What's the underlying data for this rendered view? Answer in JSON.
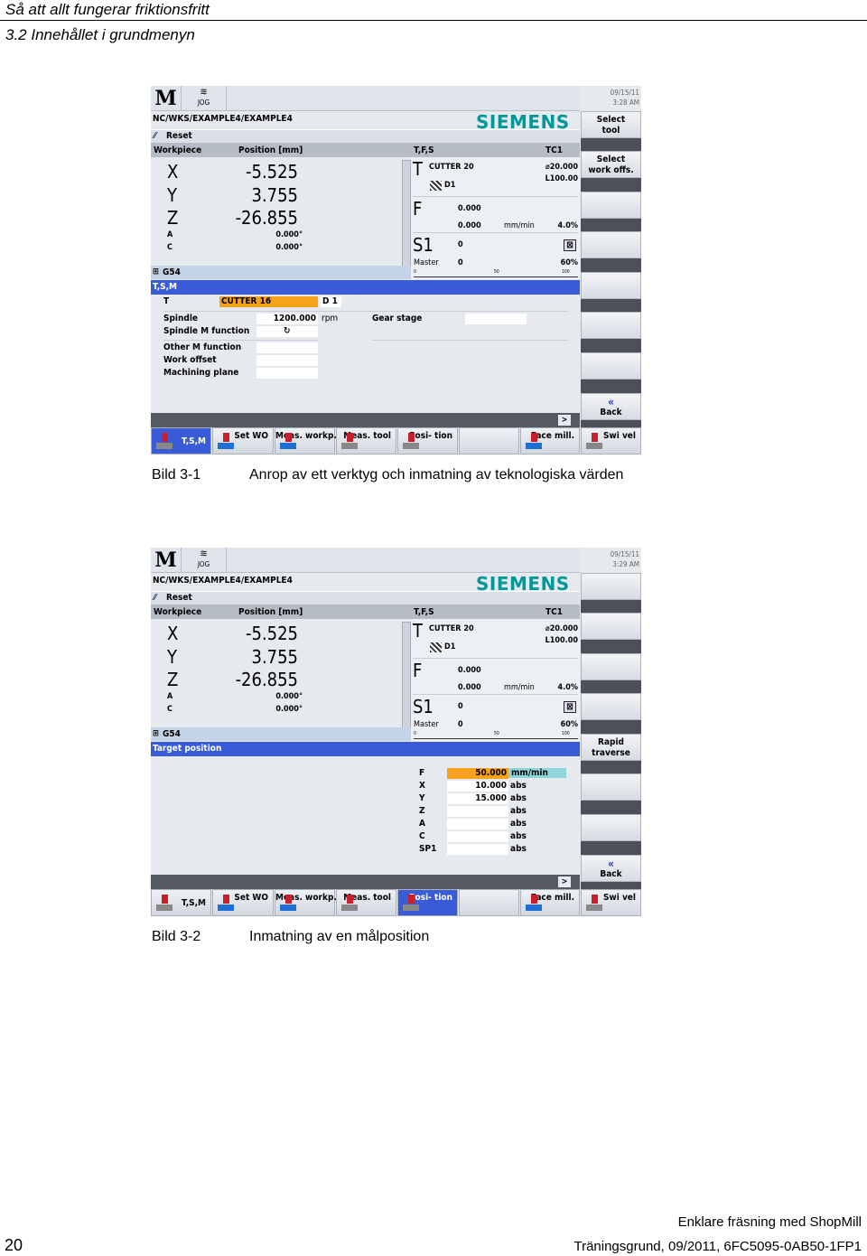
{
  "document": {
    "header_title": "Så att allt fungerar friktionsfritt",
    "header_subtitle": "3.2 Innehållet i grundmenyn",
    "figures": [
      {
        "label": "Bild 3-1",
        "caption": "Anrop av ett verktyg och inmatning av teknologiska värden"
      },
      {
        "label": "Bild 3-2",
        "caption": "Inmatning av en målposition"
      }
    ],
    "footer": {
      "page_number": "20",
      "line1": "Enklare fräsning med ShopMill",
      "line2": "Träningsgrund, 09/2011, 6FC5095-0AB50-1FP1"
    }
  },
  "colors": {
    "brand": "#00999a",
    "active_blue": "#3a5bd8",
    "highlight_orange": "#f7a21b",
    "unit_teal": "#8fd6dc"
  },
  "screens": [
    {
      "mode_icon": "M",
      "mode": "JOG",
      "date": "09/15/11",
      "time": "3:28 AM",
      "path": "NC/WKS/EXAMPLE4/EXAMPLE4",
      "brand": "SIEMENS",
      "status": "Reset",
      "pos_header": {
        "workpiece": "Workpiece",
        "position": "Position [mm]"
      },
      "axes": [
        {
          "name": "X",
          "value": "-5.525"
        },
        {
          "name": "Y",
          "value": "3.755"
        },
        {
          "name": "Z",
          "value": "-26.855"
        },
        {
          "name": "A",
          "value": "0.000°"
        },
        {
          "name": "C",
          "value": "0.000°"
        }
      ],
      "tfs": {
        "title": "T,F,S",
        "channel": "TC1",
        "t_letter": "T",
        "tool": "CUTTER 20",
        "diameter": "⌀20.000",
        "length": "L100.00",
        "d": "D1",
        "f_letter": "F",
        "f_actual": "0.000",
        "f_set": "0.000",
        "f_unit": "mm/min",
        "f_override": "4.0%",
        "s_letter": "S1",
        "s_actual": "0",
        "s_master": "Master",
        "s_set": "0",
        "s_override": "60%",
        "scale": [
          "0",
          "50",
          "100"
        ]
      },
      "g54": "G54",
      "panel_title": "T,S,M",
      "tsm": {
        "t_label": "T",
        "t_value": "CUTTER 16",
        "d_value": "D 1",
        "spindle_label": "Spindle",
        "spindle_value": "1200.000",
        "spindle_unit": "rpm",
        "gear_label": "Gear stage",
        "spindle_m_label": "Spindle M function",
        "spindle_m_value": "↻",
        "other_m_label": "Other M function",
        "work_offset_label": "Work offset",
        "plane_label": "Machining plane"
      },
      "vertical_softkeys": [
        "Select\ntool",
        "Select\nwork offs.",
        "",
        "",
        "",
        "",
        ""
      ],
      "back": "Back",
      "more": ">",
      "horizontal_softkeys": [
        "T,S,M",
        "Set\nWO",
        "Meas.\nworkp.",
        "Meas.\ntool",
        "Posi-\ntion",
        "",
        "Face\nmill.",
        "Swi\nvel"
      ],
      "active_softkey": 0
    },
    {
      "mode_icon": "M",
      "mode": "JOG",
      "date": "09/15/11",
      "time": "3:29 AM",
      "path": "NC/WKS/EXAMPLE4/EXAMPLE4",
      "brand": "SIEMENS",
      "status": "Reset",
      "pos_header": {
        "workpiece": "Workpiece",
        "position": "Position [mm]"
      },
      "axes": [
        {
          "name": "X",
          "value": "-5.525"
        },
        {
          "name": "Y",
          "value": "3.755"
        },
        {
          "name": "Z",
          "value": "-26.855"
        },
        {
          "name": "A",
          "value": "0.000°"
        },
        {
          "name": "C",
          "value": "0.000°"
        }
      ],
      "tfs": {
        "title": "T,F,S",
        "channel": "TC1",
        "t_letter": "T",
        "tool": "CUTTER 20",
        "diameter": "⌀20.000",
        "length": "L100.00",
        "d": "D1",
        "f_letter": "F",
        "f_actual": "0.000",
        "f_set": "0.000",
        "f_unit": "mm/min",
        "f_override": "4.0%",
        "s_letter": "S1",
        "s_actual": "0",
        "s_master": "Master",
        "s_set": "0",
        "s_override": "60%",
        "scale": [
          "0",
          "50",
          "100"
        ]
      },
      "g54": "G54",
      "panel_title": "Target position",
      "target": [
        {
          "axis": "F",
          "value": "50.000",
          "unit": "mm/min"
        },
        {
          "axis": "X",
          "value": "10.000",
          "unit": "abs"
        },
        {
          "axis": "Y",
          "value": "15.000",
          "unit": "abs"
        },
        {
          "axis": "Z",
          "value": "",
          "unit": "abs"
        },
        {
          "axis": "A",
          "value": "",
          "unit": "abs"
        },
        {
          "axis": "C",
          "value": "",
          "unit": "abs"
        },
        {
          "axis": "SP1",
          "value": "",
          "unit": "abs"
        }
      ],
      "vertical_softkeys": [
        "",
        "",
        "",
        "",
        "Rapid\ntraverse",
        "",
        ""
      ],
      "back": "Back",
      "more": ">",
      "horizontal_softkeys": [
        "T,S,M",
        "Set\nWO",
        "Meas.\nworkp.",
        "Meas.\ntool",
        "Posi-\ntion",
        "",
        "Face\nmill.",
        "Swi\nvel"
      ],
      "active_softkey": 4
    }
  ]
}
